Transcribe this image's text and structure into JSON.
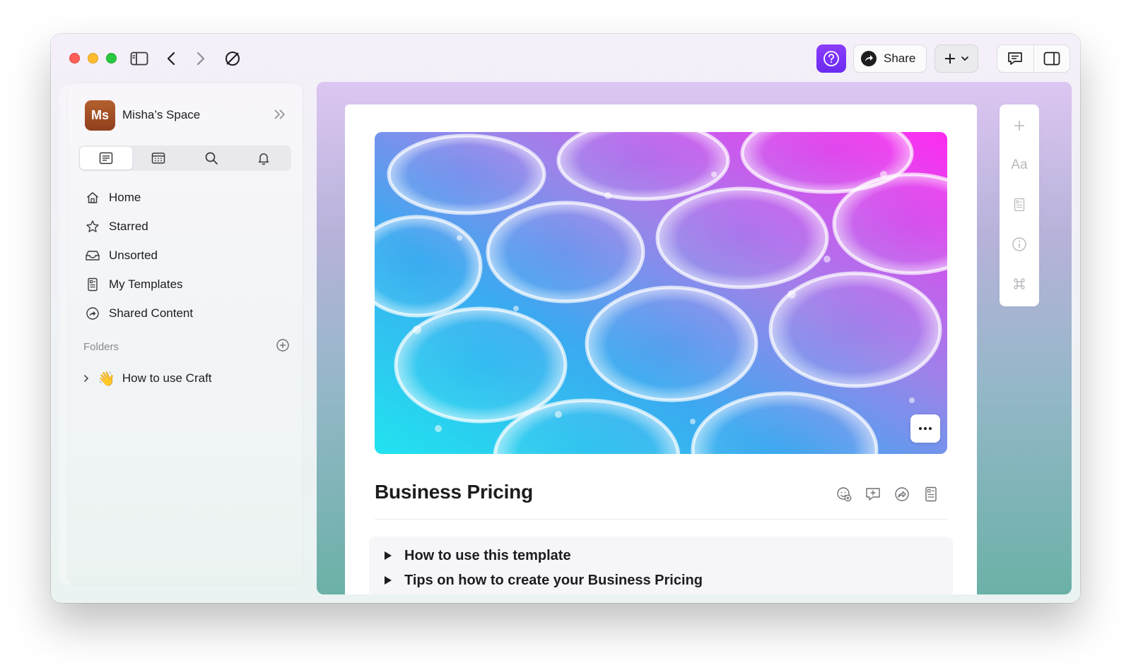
{
  "workspace": {
    "avatar_initials": "Ms",
    "name": "Misha’s Space"
  },
  "titlebar": {
    "share_label": "Share"
  },
  "sidebar": {
    "tabs": [
      "documents-icon",
      "calendar-icon",
      "search-icon",
      "bell-icon"
    ],
    "items": [
      {
        "label": "Home",
        "icon": "home-icon"
      },
      {
        "label": "Starred",
        "icon": "star-icon"
      },
      {
        "label": "Unsorted",
        "icon": "inbox-icon"
      },
      {
        "label": "My Templates",
        "icon": "template-icon"
      },
      {
        "label": "Shared Content",
        "icon": "shared-icon"
      }
    ],
    "folders_label": "Folders",
    "folders": [
      {
        "emoji": "👋",
        "label": "How to use Craft"
      }
    ]
  },
  "document": {
    "title": "Business Pricing",
    "toggles": [
      {
        "label": "How to use this template"
      },
      {
        "label": "Tips on how to create your Business Pricing"
      }
    ]
  },
  "right_toolbar": {
    "format_label": "Aa"
  },
  "colors": {
    "accent": "#7a33f7",
    "avatar": "#a0522d"
  }
}
